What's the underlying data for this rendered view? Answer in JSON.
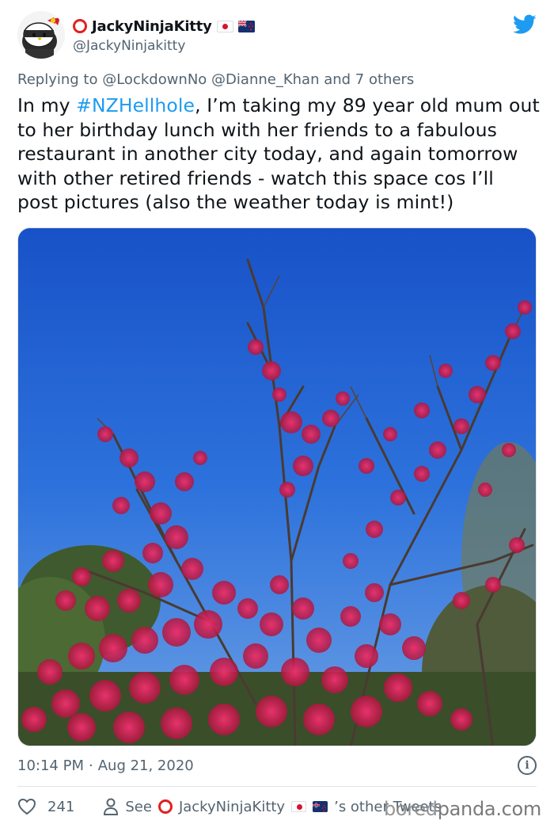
{
  "user": {
    "display_name": "JackyNinjaKitty",
    "handle": "@JackyNinjakitty",
    "avatar_icon": "hello-kitty-ninja-avatar",
    "flags": [
      "japan-flag-icon",
      "new-zealand-flag-icon"
    ]
  },
  "reply": {
    "prefix": "Replying to",
    "mentions": [
      "@LockdownNo",
      "@Dianne_Khan"
    ],
    "suffix": "and 7 others"
  },
  "tweet": {
    "text_before": "In my ",
    "hashtag": "#NZHellhole",
    "text_after": ", I’m taking my 89 year old mum out to her birthday lunch with her friends to a fabulous restaurant in another city today, and again tomorrow with other retired friends - watch this space cos I’ll post pictures (also the weather today is mint!)",
    "image_icon": "blossom-tree-photo"
  },
  "meta": {
    "time": "10:14 PM",
    "separator": "·",
    "date": "Aug 21, 2020",
    "info_glyph": "i"
  },
  "actions": {
    "like_count": "241",
    "see_prefix": "See",
    "see_name": "JackyNinjaKitty",
    "see_suffix": "’s other Tweets"
  },
  "watermark": {
    "text_a": "bored",
    "text_b": "panda.com"
  },
  "colors": {
    "accent": "#1d9bf0",
    "secondary_text": "#536471",
    "ring": "#e0211f",
    "sky": "#2a6fdc",
    "blossom": "#d8245a"
  }
}
